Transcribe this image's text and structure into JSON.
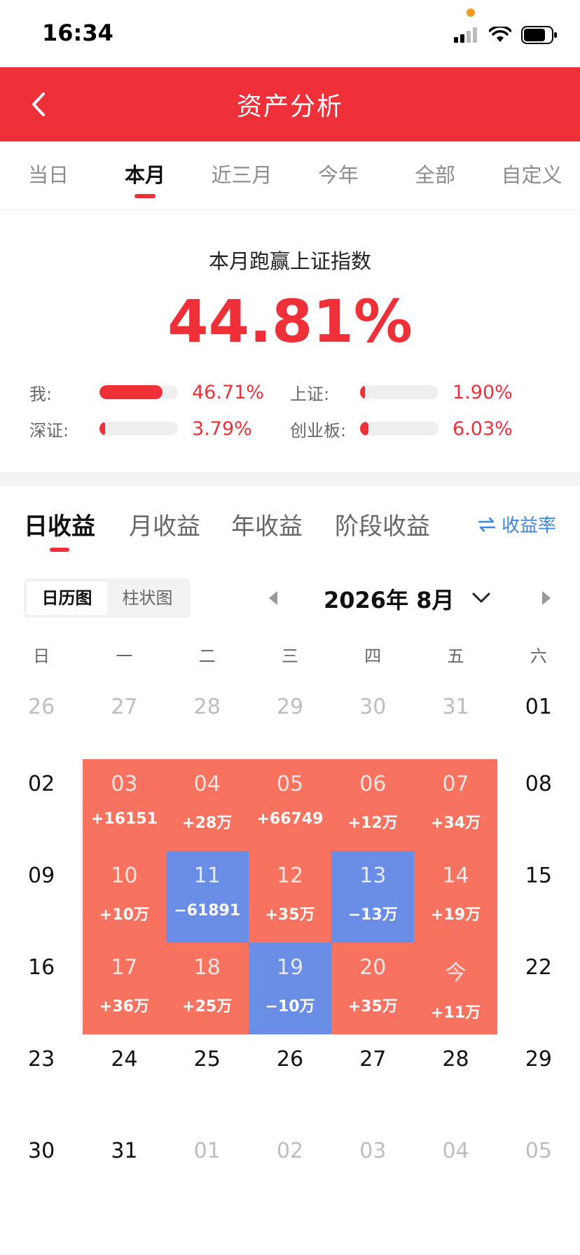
{
  "status": {
    "time": "16:34"
  },
  "nav": {
    "title": "资产分析"
  },
  "period_tabs": [
    {
      "label": "当日",
      "active": false
    },
    {
      "label": "本月",
      "active": true
    },
    {
      "label": "近三月",
      "active": false
    },
    {
      "label": "今年",
      "active": false
    },
    {
      "label": "全部",
      "active": false
    },
    {
      "label": "自定义",
      "active": false
    }
  ],
  "summary": {
    "title": "本月跑赢上证指数",
    "value": "44.81%",
    "comparisons": [
      {
        "label": "我:",
        "value": "46.71%",
        "fill": 0.8
      },
      {
        "label": "上证:",
        "value": "1.90%",
        "fill": 0.03
      },
      {
        "label": "深证:",
        "value": "3.79%",
        "fill": 0.07
      },
      {
        "label": "创业板:",
        "value": "6.03%",
        "fill": 0.11
      }
    ]
  },
  "earn_tabs": [
    {
      "label": "日收益",
      "active": true
    },
    {
      "label": "月收益",
      "active": false
    },
    {
      "label": "年收益",
      "active": false
    },
    {
      "label": "阶段收益",
      "active": false
    }
  ],
  "rate_toggle": {
    "label": "收益率",
    "icon": "swap-arrows-icon"
  },
  "view_toggle": {
    "calendar": "日历图",
    "bar": "柱状图",
    "active": "calendar"
  },
  "month": {
    "label": "2026年 8月"
  },
  "colors": {
    "brand_red": "#ef3039",
    "gain": "#f7735f",
    "loss": "#6a8de6",
    "link_blue": "#3a86e4"
  },
  "calendar": {
    "weekdays": [
      "日",
      "一",
      "二",
      "三",
      "四",
      "五",
      "六"
    ],
    "weeks": [
      [
        {
          "day": "26",
          "out": true
        },
        {
          "day": "27",
          "out": true
        },
        {
          "day": "28",
          "out": true
        },
        {
          "day": "29",
          "out": true
        },
        {
          "day": "30",
          "out": true
        },
        {
          "day": "31",
          "out": true
        },
        {
          "day": "01"
        }
      ],
      [
        {
          "day": "02"
        },
        {
          "day": "03",
          "pnl": "+16151",
          "trend": "up"
        },
        {
          "day": "04",
          "pnl": "+28万",
          "trend": "up"
        },
        {
          "day": "05",
          "pnl": "+66749",
          "trend": "up"
        },
        {
          "day": "06",
          "pnl": "+12万",
          "trend": "up"
        },
        {
          "day": "07",
          "pnl": "+34万",
          "trend": "up"
        },
        {
          "day": "08"
        }
      ],
      [
        {
          "day": "09"
        },
        {
          "day": "10",
          "pnl": "+10万",
          "trend": "up"
        },
        {
          "day": "11",
          "pnl": "−61891",
          "trend": "down"
        },
        {
          "day": "12",
          "pnl": "+35万",
          "trend": "up"
        },
        {
          "day": "13",
          "pnl": "−13万",
          "trend": "down"
        },
        {
          "day": "14",
          "pnl": "+19万",
          "trend": "up"
        },
        {
          "day": "15"
        }
      ],
      [
        {
          "day": "16"
        },
        {
          "day": "17",
          "pnl": "+36万",
          "trend": "up"
        },
        {
          "day": "18",
          "pnl": "+25万",
          "trend": "up"
        },
        {
          "day": "19",
          "pnl": "−10万",
          "trend": "down"
        },
        {
          "day": "20",
          "pnl": "+35万",
          "trend": "up"
        },
        {
          "day": "今",
          "pnl": "+11万",
          "trend": "up"
        },
        {
          "day": "22"
        }
      ],
      [
        {
          "day": "23"
        },
        {
          "day": "24"
        },
        {
          "day": "25"
        },
        {
          "day": "26"
        },
        {
          "day": "27"
        },
        {
          "day": "28"
        },
        {
          "day": "29"
        }
      ],
      [
        {
          "day": "30"
        },
        {
          "day": "31"
        },
        {
          "day": "01",
          "out": true
        },
        {
          "day": "02",
          "out": true
        },
        {
          "day": "03",
          "out": true
        },
        {
          "day": "04",
          "out": true
        },
        {
          "day": "05",
          "out": true
        }
      ]
    ]
  }
}
